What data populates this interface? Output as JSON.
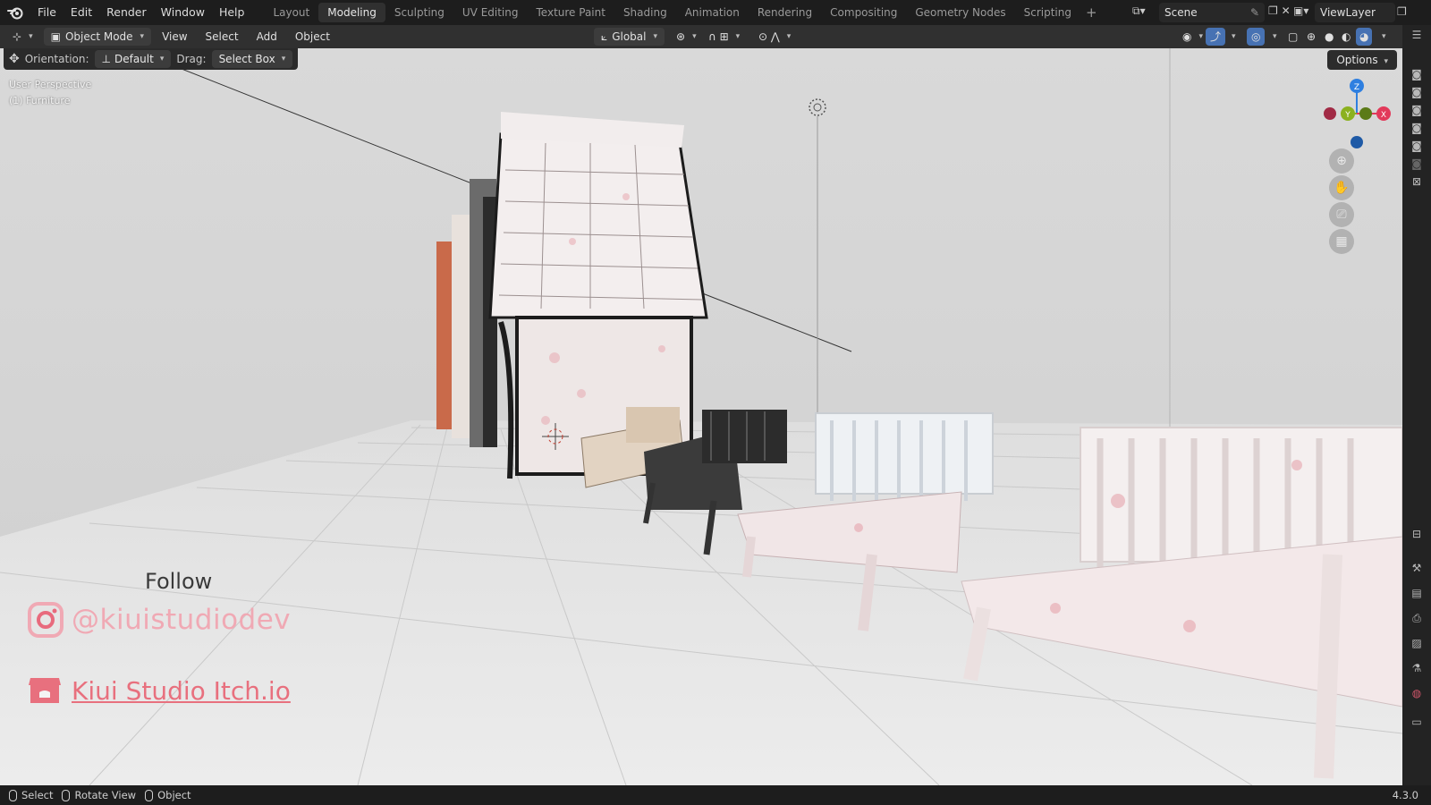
{
  "menu": [
    "File",
    "Edit",
    "Render",
    "Window",
    "Help"
  ],
  "workspaces": [
    "Layout",
    "Modeling",
    "Sculpting",
    "UV Editing",
    "Texture Paint",
    "Shading",
    "Animation",
    "Rendering",
    "Compositing",
    "Geometry Nodes",
    "Scripting"
  ],
  "active_workspace": "Modeling",
  "scene": {
    "label": "Scene"
  },
  "view_layer": {
    "label": "ViewLayer"
  },
  "header": {
    "mode": "Object Mode",
    "view": "View",
    "select": "Select",
    "add": "Add",
    "object": "Object",
    "transform_orientation": "Global"
  },
  "tool_settings": {
    "orientation_label": "Orientation:",
    "orientation_value": "Default",
    "drag_label": "Drag:",
    "drag_value": "Select Box"
  },
  "options_label": "Options",
  "viewport": {
    "perspective": "User Perspective",
    "collection": "(1) Furniture"
  },
  "gizmo": {
    "z": "Z",
    "y": "Y",
    "x": "X"
  },
  "overlay": {
    "follow": "Follow",
    "instagram": "@kiuistudiodev",
    "itch": "Kiui Studio Itch.io"
  },
  "status": {
    "select": "Select",
    "rotate": "Rotate View",
    "object": "Object",
    "version": "4.3.0"
  },
  "colors": {
    "accent_blue": "#4772b3",
    "axis_x": "#e2395a",
    "axis_y": "#8bb11f",
    "axis_z": "#2e7fe0",
    "instagram_pink": "#f0a9b4"
  }
}
